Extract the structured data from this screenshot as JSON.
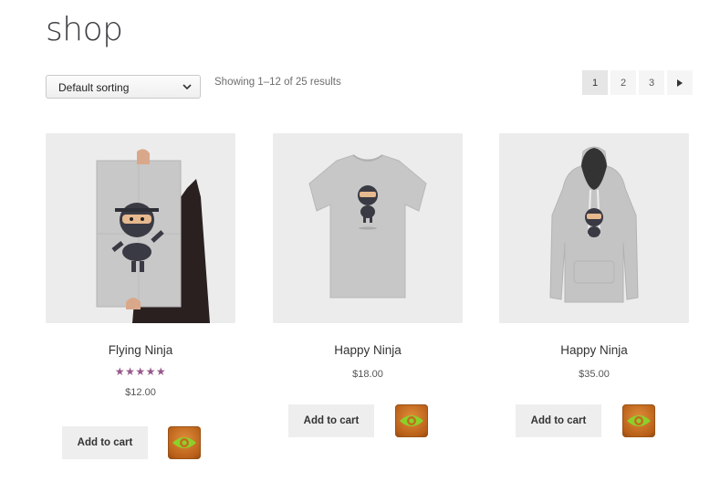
{
  "page": {
    "title": "shop"
  },
  "sorting": {
    "selected": "Default sorting"
  },
  "results": {
    "count_text": "Showing 1–12 of 25 results"
  },
  "pagination": {
    "pages": [
      "1",
      "2",
      "3"
    ],
    "current": "1",
    "next_icon": "triangle-right-icon"
  },
  "products": [
    {
      "name": "Flying Ninja",
      "rating": 5,
      "rating_stars": "★★★★★",
      "price": "$12.00",
      "add_to_cart_label": "Add to cart",
      "quickview_icon": "eye-icon"
    },
    {
      "name": "Happy Ninja",
      "price": "$18.00",
      "add_to_cart_label": "Add to cart",
      "quickview_icon": "eye-icon"
    },
    {
      "name": "Happy Ninja",
      "price": "$35.00",
      "add_to_cart_label": "Add to cart",
      "quickview_icon": "eye-icon"
    }
  ],
  "colors": {
    "rating": "#96588a",
    "button_bg": "#eeeeee",
    "quickview_bg": "#c66a1f",
    "quickview_eye": "#8cd12a"
  }
}
